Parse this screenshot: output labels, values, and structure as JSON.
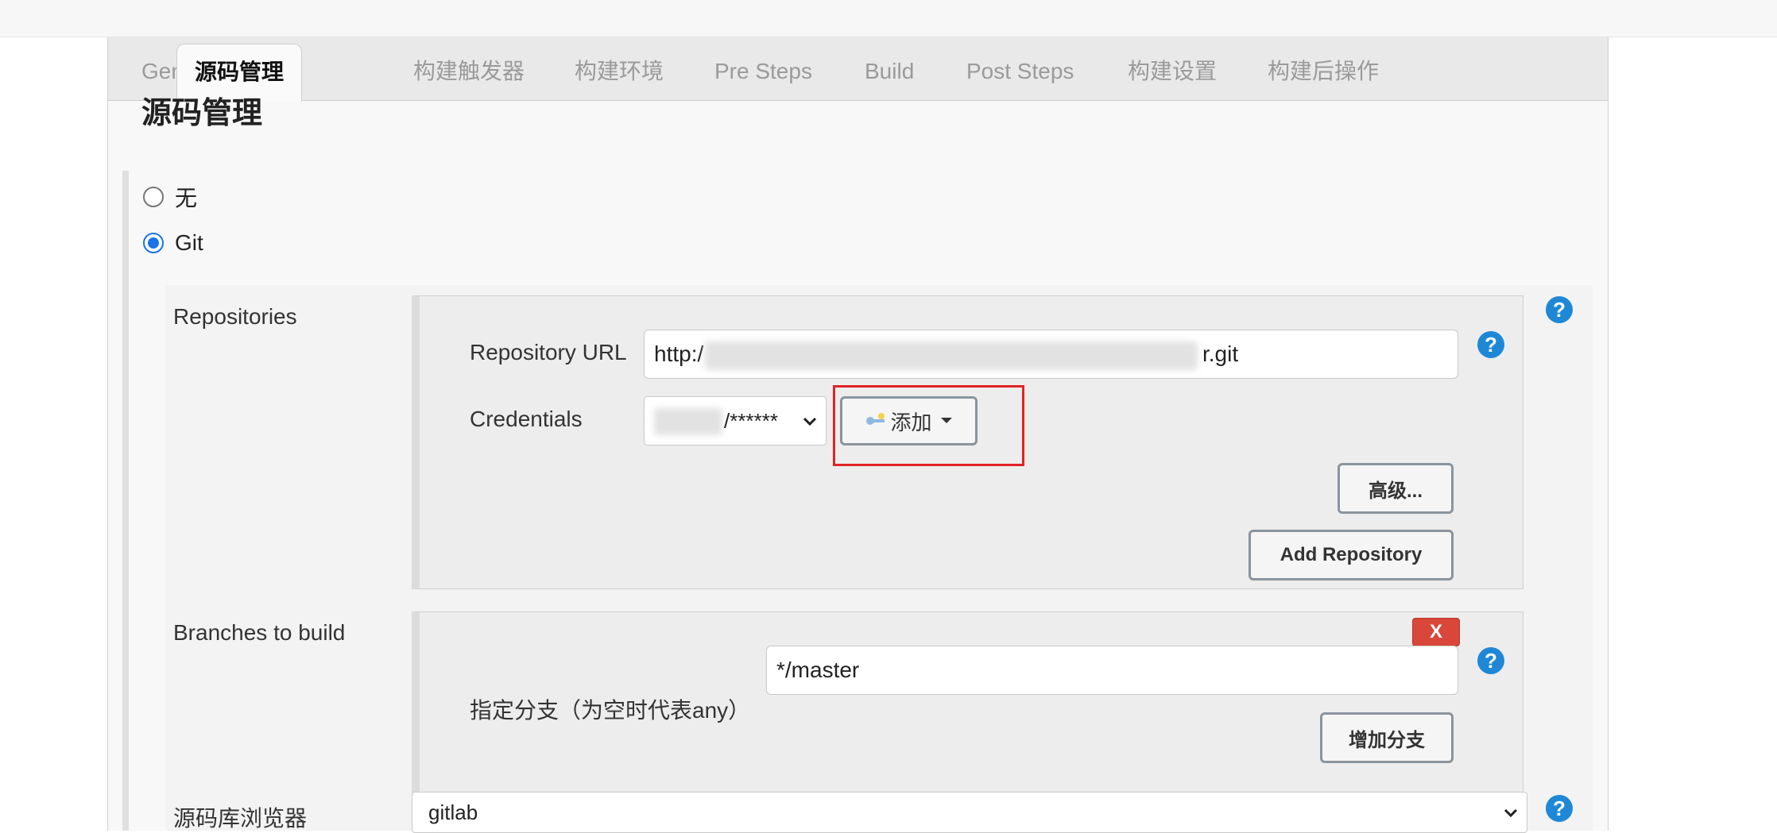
{
  "tabs": [
    "General",
    "源码管理",
    "构建触发器",
    "构建环境",
    "Pre Steps",
    "Build",
    "Post Steps",
    "构建设置",
    "构建后操作"
  ],
  "section_title": "源码管理",
  "scm_options": {
    "none_label": "无",
    "git_label": "Git",
    "selected": "Git"
  },
  "repositories": {
    "label": "Repositories",
    "url_label": "Repository URL",
    "url_prefix": "http:/",
    "url_suffix": "r.git",
    "credentials_label": "Credentials",
    "credentials_value": "/******",
    "add_button": "添加",
    "advanced_button": "高级...",
    "add_repository_button": "Add Repository"
  },
  "branches": {
    "label": "Branches to build",
    "specifier_label": "指定分支（为空时代表any）",
    "specifier_value": "*/master",
    "delete_button": "X",
    "add_branch_button": "增加分支"
  },
  "browser": {
    "label": "源码库浏览器",
    "value": "gitlab"
  },
  "help_icon": "?",
  "colors": {
    "accent": "#1e88d6",
    "radio_checked": "#1a73e8",
    "delete": "#d9463a",
    "highlight": "#e02424"
  }
}
